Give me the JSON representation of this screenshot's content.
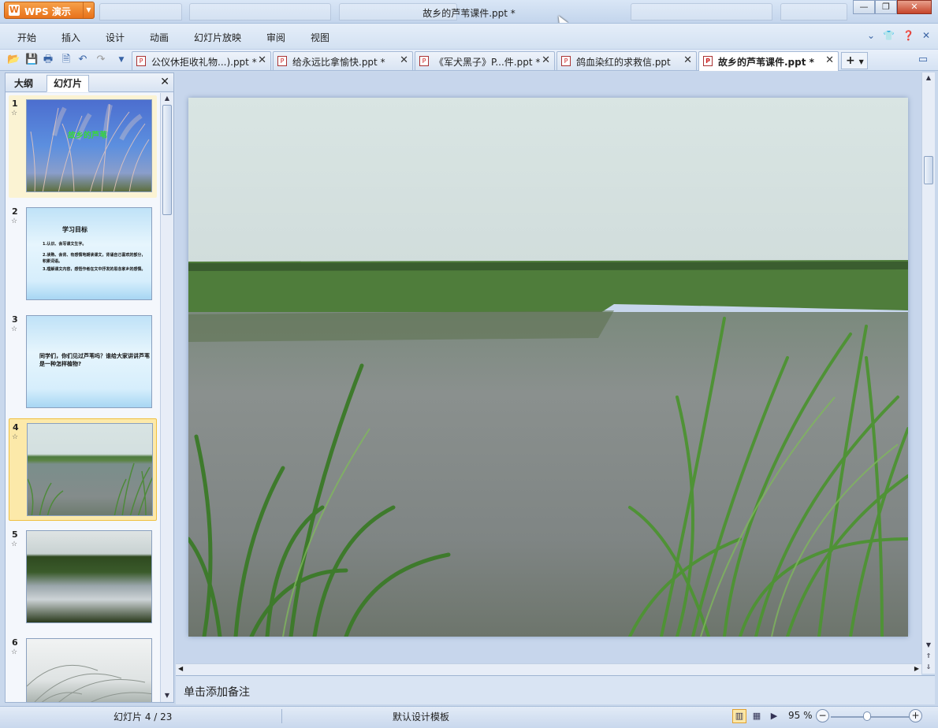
{
  "app": {
    "name": "WPS 演示",
    "logo": "W"
  },
  "window": {
    "title": "故乡的芦苇课件.ppt *"
  },
  "menu": {
    "items": [
      "开始",
      "插入",
      "设计",
      "动画",
      "幻灯片放映",
      "审阅",
      "视图"
    ]
  },
  "tabs": [
    {
      "label": "公仪休拒收礼物...).ppt *",
      "active": false
    },
    {
      "label": "给永远比拿愉快.ppt *",
      "active": false
    },
    {
      "label": "《军犬黑子》P...件.ppt *",
      "active": false
    },
    {
      "label": "鸽血染红的求救信.ppt",
      "active": false
    },
    {
      "label": "故乡的芦苇课件.ppt *",
      "active": true
    }
  ],
  "pane": {
    "tab_outline": "大纲",
    "tab_slides": "幻灯片"
  },
  "thumbnails": [
    {
      "number": "1",
      "title": "故乡的芦苇"
    },
    {
      "number": "2",
      "heading": "学习目标",
      "lines": [
        "1.认识、会写课文生字。",
        "2.读熟、会背、有感情地朗读课文，背诵自己喜欢的部分，积累词语。",
        "3.理解课文内容，感悟作者在文中抒发的思念家乡的感情。"
      ]
    },
    {
      "number": "3",
      "text": "同学们，你们见过芦苇吗？谁给大家讲讲芦苇是一种怎样植物?"
    },
    {
      "number": "4",
      "selected": true
    },
    {
      "number": "5"
    },
    {
      "number": "6"
    }
  ],
  "notes": {
    "placeholder": "单击添加备注"
  },
  "status": {
    "slide_indicator": "幻灯片 4 / 23",
    "template": "默认设计模板",
    "zoom": "95 %"
  },
  "colors": {
    "app_orange": "#e8721b",
    "selection": "#fce9a9"
  }
}
